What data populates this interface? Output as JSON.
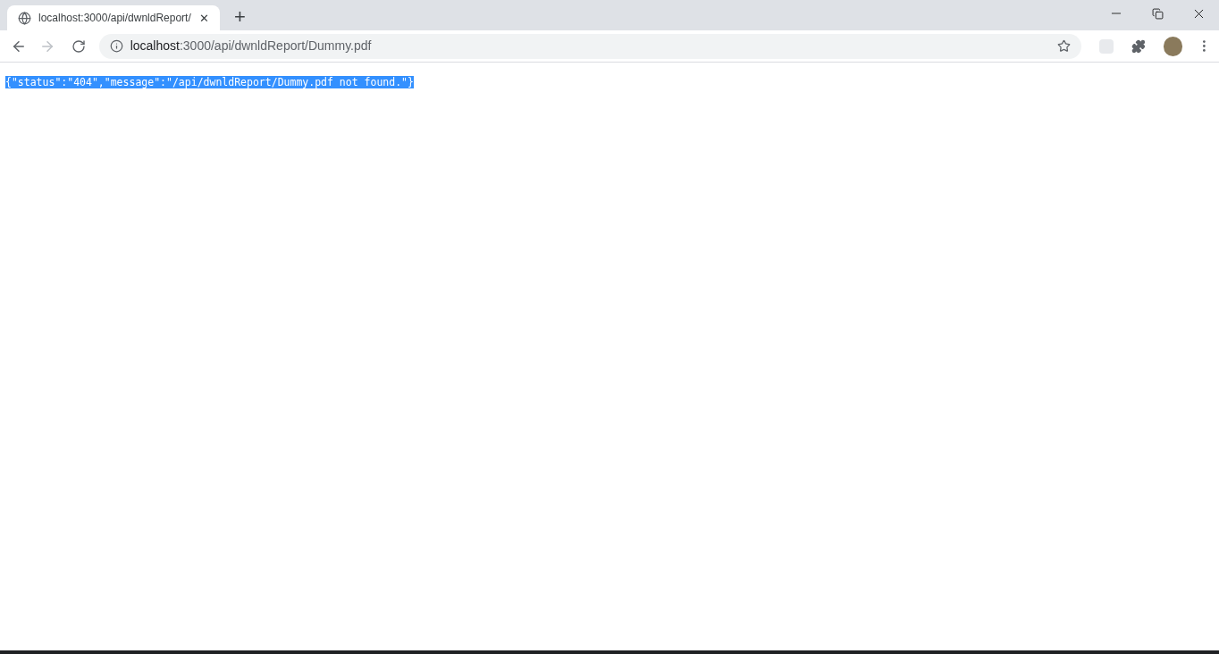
{
  "tab": {
    "title": "localhost:3000/api/dwnldReport/",
    "close": "✕",
    "new_tab": "+"
  },
  "address_bar": {
    "url_host": "localhost",
    "url_rest": ":3000/api/dwnldReport/Dummy.pdf"
  },
  "page": {
    "body": "{\"status\":\"404\",\"message\":\"/api/dwnldReport/Dummy.pdf not found.\"}",
    "selected": true
  }
}
